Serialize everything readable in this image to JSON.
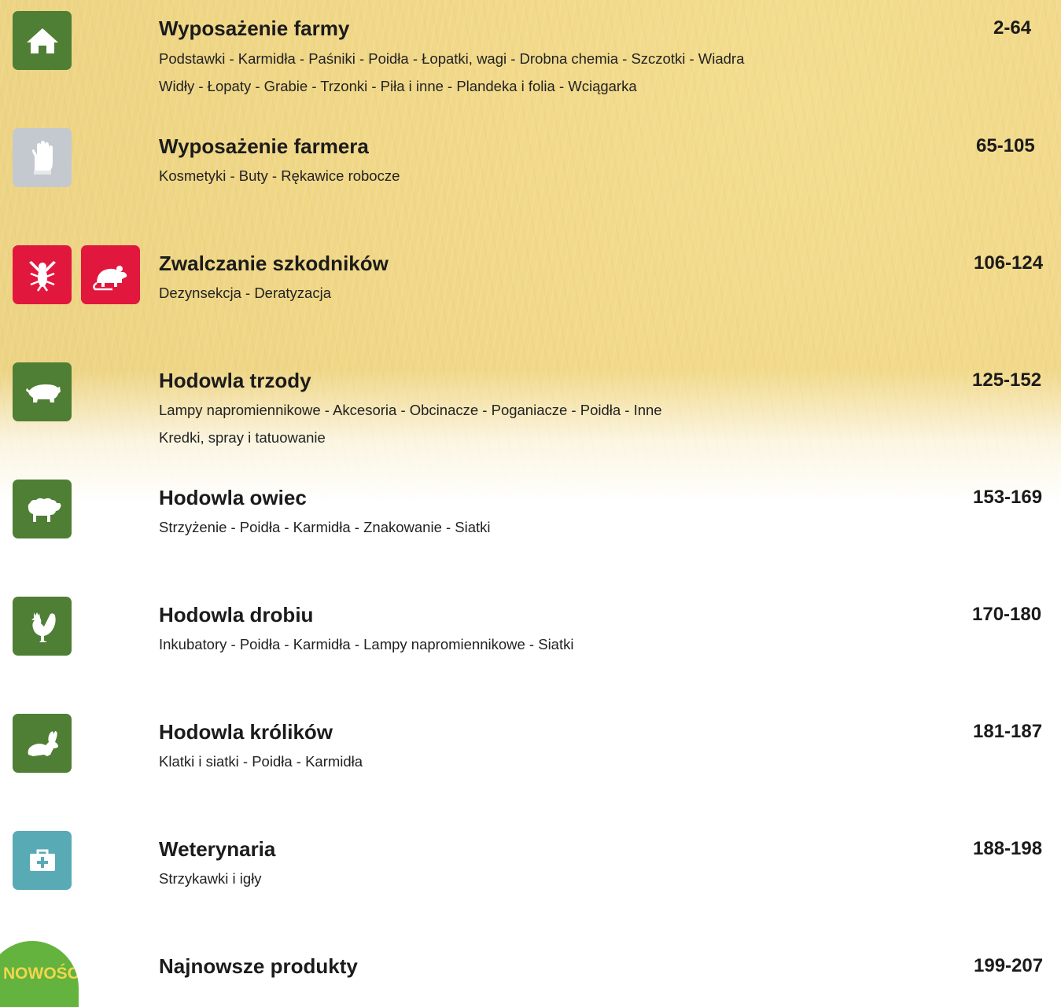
{
  "sections": [
    {
      "icon": "house-icon",
      "icon_color": "#4e7f34",
      "title": "Wyposażenie farmy",
      "pages": "2-64",
      "lines": [
        "Podstawki - Karmidła - Paśniki - Poidła - Łopatki, wagi - Drobna chemia - Szczotki - Wiadra",
        "Widły - Łopaty - Grabie - Trzonki - Piła i inne - Plandeka i folia - Wciągarka"
      ]
    },
    {
      "icon": "glove-icon",
      "icon_color": "#c4c8cf",
      "title": "Wyposażenie farmera",
      "pages": "65-105",
      "lines": [
        "Kosmetyki - Buty - Rękawice robocze"
      ]
    },
    {
      "icon": "fly-icon",
      "icon2": "rat-icon",
      "icon_color": "#e2173e",
      "title": "Zwalczanie szkodników",
      "pages": "106-124",
      "lines": [
        "Dezynsekcja - Deratyzacja"
      ]
    },
    {
      "icon": "pig-icon",
      "icon_color": "#4e7f34",
      "title": "Hodowla trzody",
      "pages": "125-152",
      "lines": [
        "Lampy napromiennikowe - Akcesoria - Obcinacze - Poganiacze - Poidła - Inne",
        "Kredki, spray i tatuowanie"
      ]
    },
    {
      "icon": "sheep-icon",
      "icon_color": "#4e7f34",
      "title": "Hodowla owiec",
      "pages": "153-169",
      "lines": [
        "Strzyżenie - Poidła - Karmidła - Znakowanie - Siatki"
      ]
    },
    {
      "icon": "rooster-icon",
      "icon_color": "#4e7f34",
      "title": "Hodowla drobiu",
      "pages": "170-180",
      "lines": [
        "Inkubatory - Poidła - Karmidła - Lampy napromiennikowe - Siatki"
      ]
    },
    {
      "icon": "rabbit-icon",
      "icon_color": "#4e7f34",
      "title": "Hodowla królików",
      "pages": "181-187",
      "lines": [
        "Klatki i siatki - Poidła - Karmidła"
      ]
    },
    {
      "icon": "medical-kit-icon",
      "icon_color": "#58aab5",
      "title": "Weterynaria",
      "pages": "188-198",
      "lines": [
        "Strzykawki i igły"
      ]
    },
    {
      "icon": "new-badge-icon",
      "icon_color": "#63b33e",
      "badge_text": "NOWOŚĆ",
      "title": "Najnowsze produkty",
      "pages": "199-207",
      "lines": []
    }
  ]
}
